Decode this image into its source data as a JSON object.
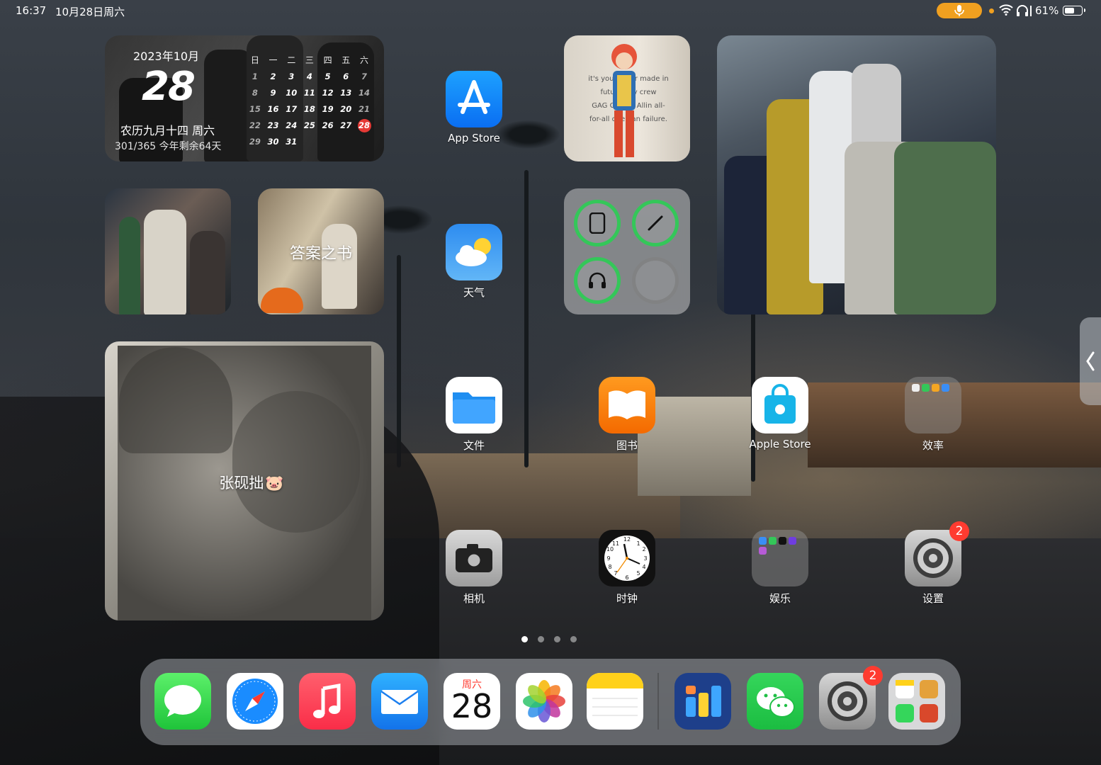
{
  "status_bar": {
    "time": "16:37",
    "date": "10月28日周六",
    "battery_percent": "61%",
    "battery_level": 0.61
  },
  "calendar_widget": {
    "year_month": "2023年10月",
    "day": "28",
    "lunar": "农历九月十四 周六",
    "progress": "301/365 今年剩余64天",
    "weekdays": [
      "日",
      "一",
      "二",
      "三",
      "四",
      "五",
      "六"
    ],
    "weeks": [
      [
        "1",
        "2",
        "3",
        "4",
        "5",
        "6",
        "7"
      ],
      [
        "8",
        "9",
        "10",
        "11",
        "12",
        "13",
        "14"
      ],
      [
        "15",
        "16",
        "17",
        "18",
        "19",
        "20",
        "21"
      ],
      [
        "22",
        "23",
        "24",
        "25",
        "26",
        "27",
        "28"
      ],
      [
        "29",
        "30",
        "31",
        "",
        "",
        "",
        ""
      ]
    ],
    "today": "28"
  },
  "answer_widget": {
    "label": "答案之书"
  },
  "polaroid_widget": {
    "caption": "张砚拙",
    "emoji": "🐷"
  },
  "anime_widget": {
    "lines": [
      "it's your b  per made in",
      "future,      my crew",
      "GAG G  Grou  Allin all-",
      "for-all doe   ean failure."
    ]
  },
  "apps": {
    "app_store": "App Store",
    "weather": "天气",
    "files": "文件",
    "books": "图书",
    "apple_store": "Apple Store",
    "productivity": "效率",
    "camera": "相机",
    "clock": "时钟",
    "entertainment": "娱乐",
    "settings": "设置",
    "settings_badge": "2"
  },
  "dock": {
    "calendar_weekday": "周六",
    "calendar_day": "28",
    "settings_badge": "2"
  },
  "colors": {
    "accent_green": "#34c759",
    "badge_red": "#ff3b30",
    "mic_orange": "#f0a020"
  }
}
